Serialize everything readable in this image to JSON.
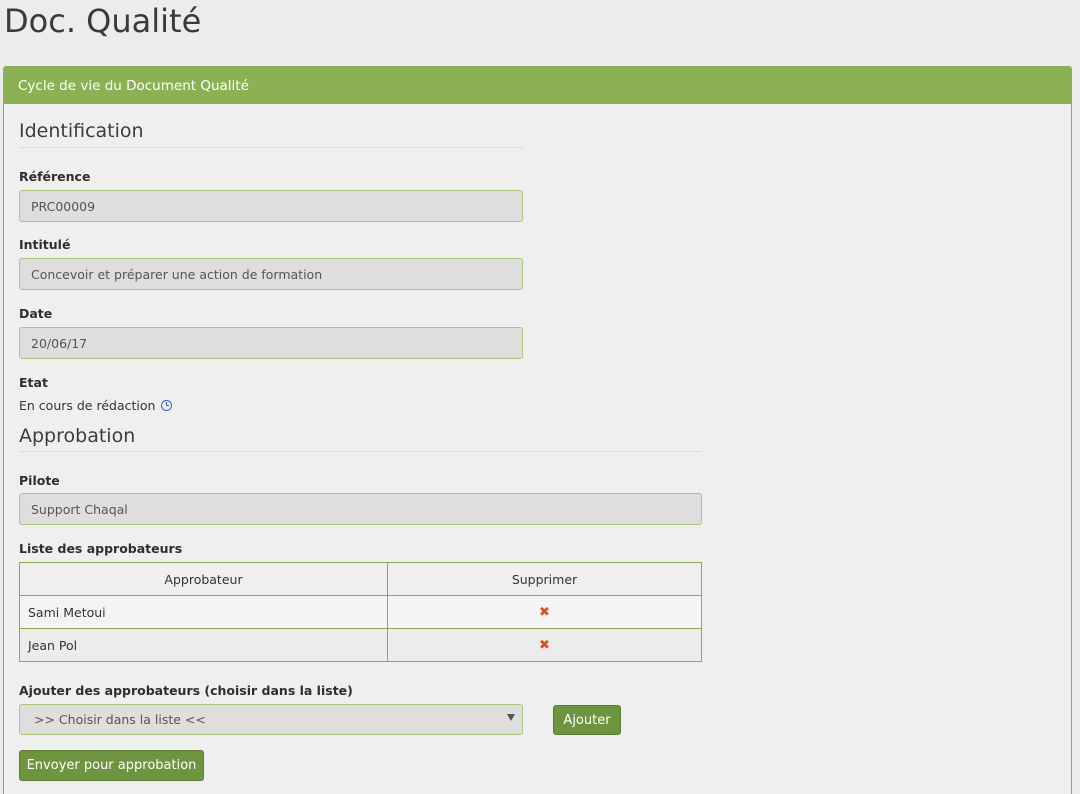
{
  "page": {
    "title": "Doc. Qualité"
  },
  "panel": {
    "header": "Cycle de vie du Document Qualité"
  },
  "identification": {
    "title": "Identification",
    "reference": {
      "label": "Référence",
      "value": "PRC00009"
    },
    "intitule": {
      "label": "Intitulé",
      "value": "Concevoir et préparer une action de formation"
    },
    "date": {
      "label": "Date",
      "value": "20/06/17"
    },
    "etat": {
      "label": "Etat",
      "value": "En cours de rédaction",
      "icon": "clock-icon"
    }
  },
  "approbation": {
    "title": "Approbation",
    "pilote": {
      "label": "Pilote",
      "value": "Support Chaqal"
    },
    "liste_label": "Liste des approbateurs",
    "table": {
      "columns": [
        "Approbateur",
        "Supprimer"
      ],
      "rows": [
        {
          "name": "Sami Metoui",
          "delete_icon": "✖"
        },
        {
          "name": "Jean Pol",
          "delete_icon": "✖"
        }
      ]
    },
    "ajouter_label": "Ajouter des approbateurs (choisir dans la liste)",
    "select_value": ">> Choisir dans la liste <<",
    "ajouter_button": "Ajouter",
    "envoyer_button": "Envoyer pour approbation"
  },
  "colors": {
    "accent": "#8cb154",
    "button": "#6f9440",
    "delete": "#d9531e",
    "clock": "#3a5fcd"
  }
}
